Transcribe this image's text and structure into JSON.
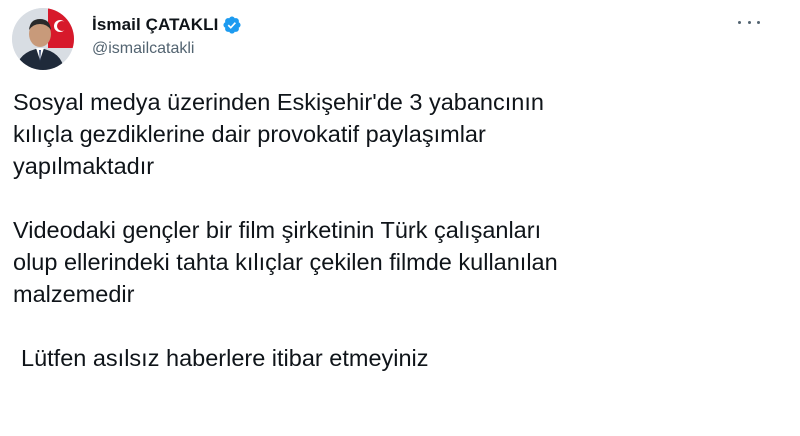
{
  "author": {
    "display_name": "İsmail ÇATAKLI",
    "handle": "@ismailcatakli",
    "verified_icon": "verified-badge-icon",
    "accent_color": "#1d9bf0"
  },
  "more_icon": "more-options-icon",
  "tweet": {
    "paragraphs": [
      [
        "Sosyal medya üzerinden Eskişehir'de 3 yabancının",
        "kılıçla gezdiklerine dair provokatif paylaşımlar",
        "yapılmaktadır"
      ],
      [
        "Videodaki gençler bir film şirketinin Türk çalışanları",
        "olup ellerindeki tahta kılıçlar çekilen filmde kullanılan",
        "malzemedir"
      ],
      [
        "Lütfen asılsız haberlere itibar etmeyiniz"
      ]
    ]
  }
}
